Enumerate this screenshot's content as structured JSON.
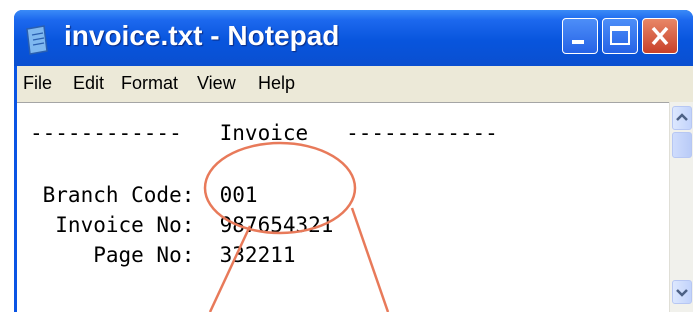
{
  "window": {
    "title": "invoice.txt - Notepad",
    "icon": "notepad-icon",
    "controls": [
      "minimize-icon",
      "maximize-icon",
      "close-icon"
    ]
  },
  "menu": [
    "File",
    "Edit",
    "Format",
    "View",
    "Help"
  ],
  "document": {
    "line1": "------------   Invoice   ------------",
    "line2": "",
    "line3": " Branch Code:  001",
    "line4": "  Invoice No:  987654321",
    "line5": "     Page No:  332211"
  },
  "colors": {
    "titlebar": "#0a54e4",
    "menubar": "#ece9d8",
    "annotation": "#e87a5a"
  }
}
